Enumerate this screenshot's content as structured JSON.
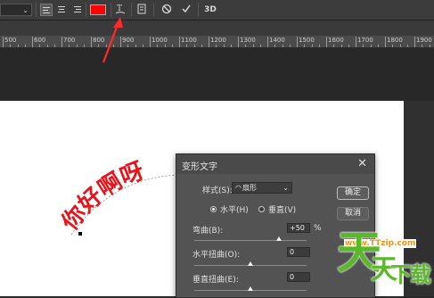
{
  "options_bar": {
    "size_value": "",
    "text_color": "#ff0000",
    "warp_icon": "warp-text-icon",
    "panels_icon": "character-paragraph-panels-icon",
    "cancel_icon": "cancel-icon",
    "commit_icon": "commit-checkmark-icon",
    "three_d_label": "3D"
  },
  "ruler": {
    "labels": [
      "500",
      "600",
      "700",
      "800",
      "900",
      "1000",
      "1100",
      "1200",
      "1300",
      "1400",
      "1500",
      "1600",
      "1700",
      "1800",
      "1900",
      "2000"
    ]
  },
  "canvas": {
    "warped_text": "你好啊呀",
    "text_color": "#e8141c"
  },
  "warp_dialog": {
    "title": "变形文字",
    "style_label": "样式(S):",
    "style_value": "扇形",
    "horizontal_label": "水平(H)",
    "vertical_label": "垂直(V)",
    "orientation_selected": "horizontal",
    "bend_label": "弯曲(B):",
    "bend_value": "+50",
    "bend_unit": "%",
    "bend_percent": 50,
    "hdistort_label": "水平扭曲(O):",
    "hdistort_value": "0",
    "hdistort_percent": 0,
    "vdistort_label": "垂直扭曲(E):",
    "vdistort_value": "0",
    "vdistort_percent": 0,
    "ok_label": "确定",
    "cancel_label": "取消"
  },
  "watermark": {
    "url": "www.TTzip.com",
    "text": "天天下载"
  },
  "annotation": {
    "arrow_color": "#ff2a2a"
  }
}
